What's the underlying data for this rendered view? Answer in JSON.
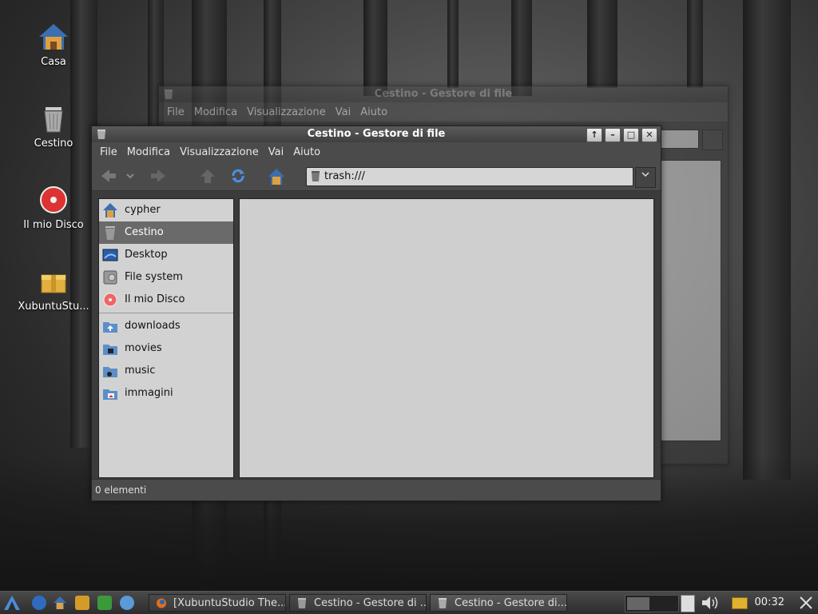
{
  "desktop": {
    "icons": [
      {
        "label": "Casa"
      },
      {
        "label": "Cestino"
      },
      {
        "label": "Il mio Disco"
      },
      {
        "label": "XubuntuStu..."
      }
    ]
  },
  "back_window": {
    "title": "Cestino - Gestore di file",
    "menu": [
      "File",
      "Modifica",
      "Visualizzazione",
      "Vai",
      "Aiuto"
    ]
  },
  "front_window": {
    "title": "Cestino - Gestore di file",
    "buttons": {
      "up": "↑",
      "minimize": "–",
      "maximize": "□",
      "close": "✕"
    },
    "menu": [
      "File",
      "Modifica",
      "Visualizzazione",
      "Vai",
      "Aiuto"
    ],
    "address": "trash:///",
    "sidebar": {
      "places": [
        {
          "label": "cypher",
          "icon": "home-icon"
        },
        {
          "label": "Cestino",
          "icon": "trash-icon",
          "selected": true
        },
        {
          "label": "Desktop",
          "icon": "desktop-icon"
        },
        {
          "label": "File system",
          "icon": "drive-icon"
        },
        {
          "label": "Il mio Disco",
          "icon": "disc-icon"
        }
      ],
      "bookmarks": [
        {
          "label": "downloads",
          "icon": "folder-download-icon"
        },
        {
          "label": "movies",
          "icon": "folder-video-icon"
        },
        {
          "label": "music",
          "icon": "folder-music-icon"
        },
        {
          "label": "immagini",
          "icon": "folder-pictures-icon"
        }
      ]
    },
    "status": "0 elementi"
  },
  "taskbar": {
    "tasks": [
      {
        "label": "[XubuntuStudio The..."
      },
      {
        "label": "Cestino - Gestore di ..."
      },
      {
        "label": "Cestino - Gestore di..."
      }
    ],
    "clock": "00:32"
  }
}
